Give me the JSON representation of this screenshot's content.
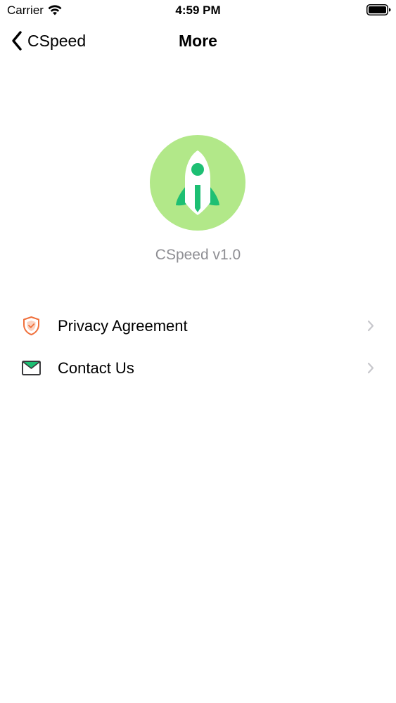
{
  "status_bar": {
    "carrier": "Carrier",
    "time": "4:59 PM",
    "wifi_icon": "wifi-icon",
    "battery_icon": "battery-icon"
  },
  "nav": {
    "back_label": "CSpeed",
    "title": "More"
  },
  "app": {
    "logo_icon": "rocket-icon",
    "version": "CSpeed v1.0"
  },
  "menu": {
    "items": [
      {
        "label": "Privacy Agreement",
        "icon": "shield-check-icon"
      },
      {
        "label": "Contact Us",
        "icon": "envelope-icon"
      }
    ]
  },
  "colors": {
    "logo_background": "#b2e889",
    "accent_green": "#1dbf73",
    "shield_orange": "#f0703c",
    "secondary_text": "#8e8e93"
  }
}
